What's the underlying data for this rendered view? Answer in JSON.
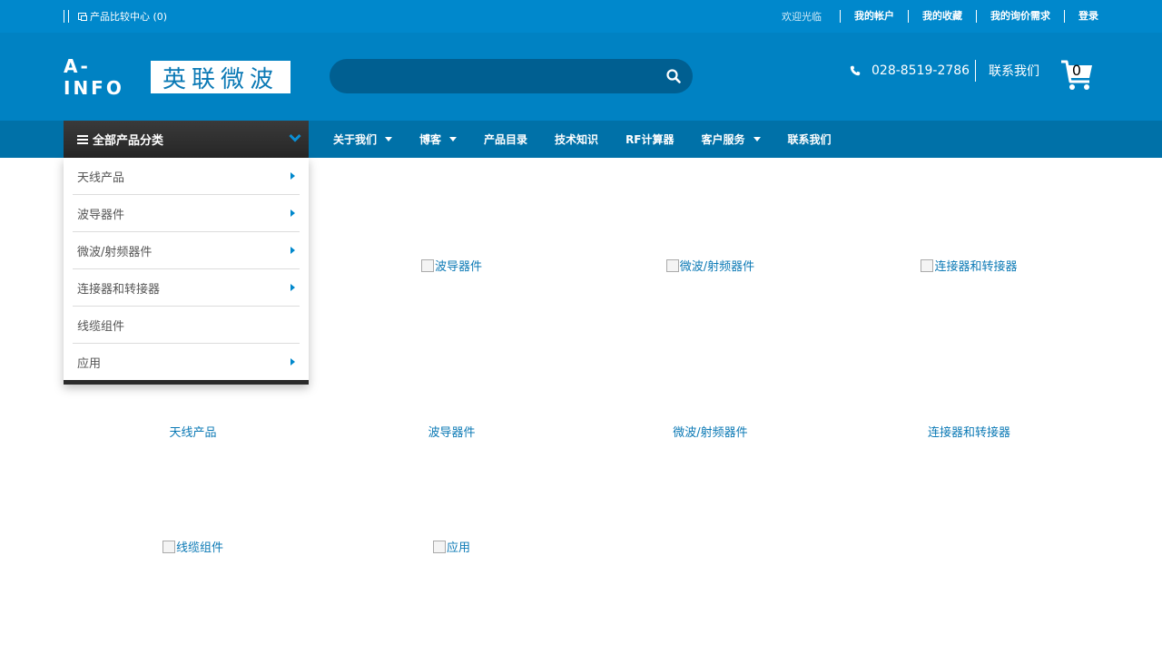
{
  "topbar": {
    "compare_label": "产品比较中心 (0)",
    "welcome": "欢迎光临",
    "links": [
      "我的帐户",
      "我的收藏",
      "我的询价需求",
      "登录"
    ]
  },
  "header": {
    "logo_en": "A-INFO",
    "logo_cn": "英联微波",
    "search_placeholder": "",
    "phone": "028-8519-2786",
    "contact": "联系我们",
    "cart_count": "0"
  },
  "nav": {
    "category_button": "全部产品分类",
    "items": [
      {
        "label": "关于我们",
        "dropdown": true
      },
      {
        "label": "博客",
        "dropdown": true
      },
      {
        "label": "产品目录",
        "dropdown": false
      },
      {
        "label": "技术知识",
        "dropdown": false
      },
      {
        "label": "RF计算器",
        "dropdown": false
      },
      {
        "label": "客户服务",
        "dropdown": true
      },
      {
        "label": "联系我们",
        "dropdown": false
      }
    ]
  },
  "category_menu": [
    {
      "label": "天线产品",
      "has_sub": true
    },
    {
      "label": "波导器件",
      "has_sub": true
    },
    {
      "label": "微波/射频器件",
      "has_sub": true
    },
    {
      "label": "连接器和转接器",
      "has_sub": true
    },
    {
      "label": "线缆组件",
      "has_sub": false
    },
    {
      "label": "应用",
      "has_sub": true
    }
  ],
  "products": [
    {
      "alt": "天线产品",
      "caption": "天线产品"
    },
    {
      "alt": "波导器件",
      "caption": "波导器件"
    },
    {
      "alt": "微波/射频器件",
      "caption": "微波/射频器件"
    },
    {
      "alt": "连接器和转接器",
      "caption": "连接器和转接器"
    },
    {
      "alt": "线缆组件",
      "caption": ""
    },
    {
      "alt": "应用",
      "caption": ""
    }
  ],
  "colors": {
    "topbar": "#0088cc",
    "header": "#0082c3",
    "navbar": "#0071a8",
    "category_button": "#2b2b2b",
    "link": "#0b79b5"
  }
}
